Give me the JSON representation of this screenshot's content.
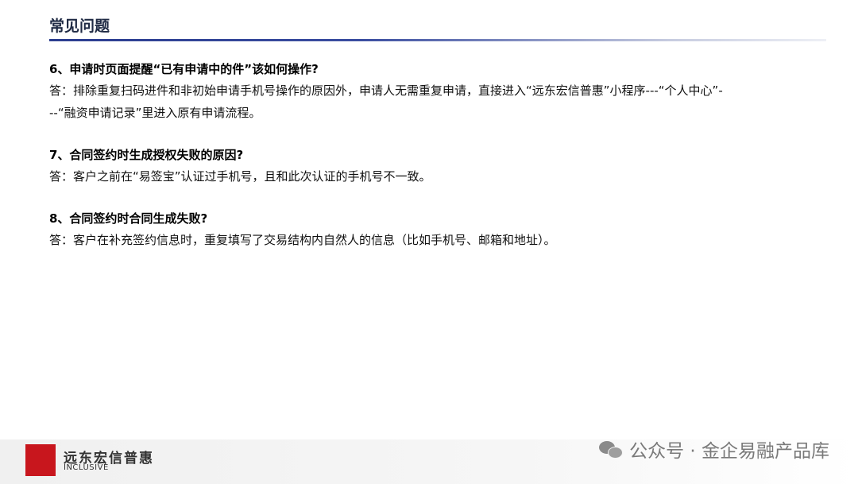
{
  "header": {
    "title": "常见问题"
  },
  "faq": [
    {
      "question": "6、申请时页面提醒“已有申请中的件”该如何操作?",
      "answer_line1": "答：排除重复扫码进件和非初始申请手机号操作的原因外，申请人无需重复申请，直接进入“远东宏信普惠”小程序---“个人中心”-",
      "answer_line2": "--“融资申请记录”里进入原有申请流程。"
    },
    {
      "question": "7、合同签约时生成授权失败的原因?",
      "answer_line1": "答：客户之前在“易签宝”认证过手机号，且和此次认证的手机号不一致。"
    },
    {
      "question": "8、合同签约时合同生成失败?",
      "answer_line1": "答：客户在补充签约信息时，重复填写了交易结构内自然人的信息（比如手机号、邮箱和地址）。"
    }
  ],
  "footer": {
    "brand_cn": "远东宏信普惠",
    "brand_en": "INCLUSIVE",
    "watermark_right": "公众号 · 金企易融产品库",
    "icon": "wechat-icon",
    "accent_color": "#c8161d"
  }
}
